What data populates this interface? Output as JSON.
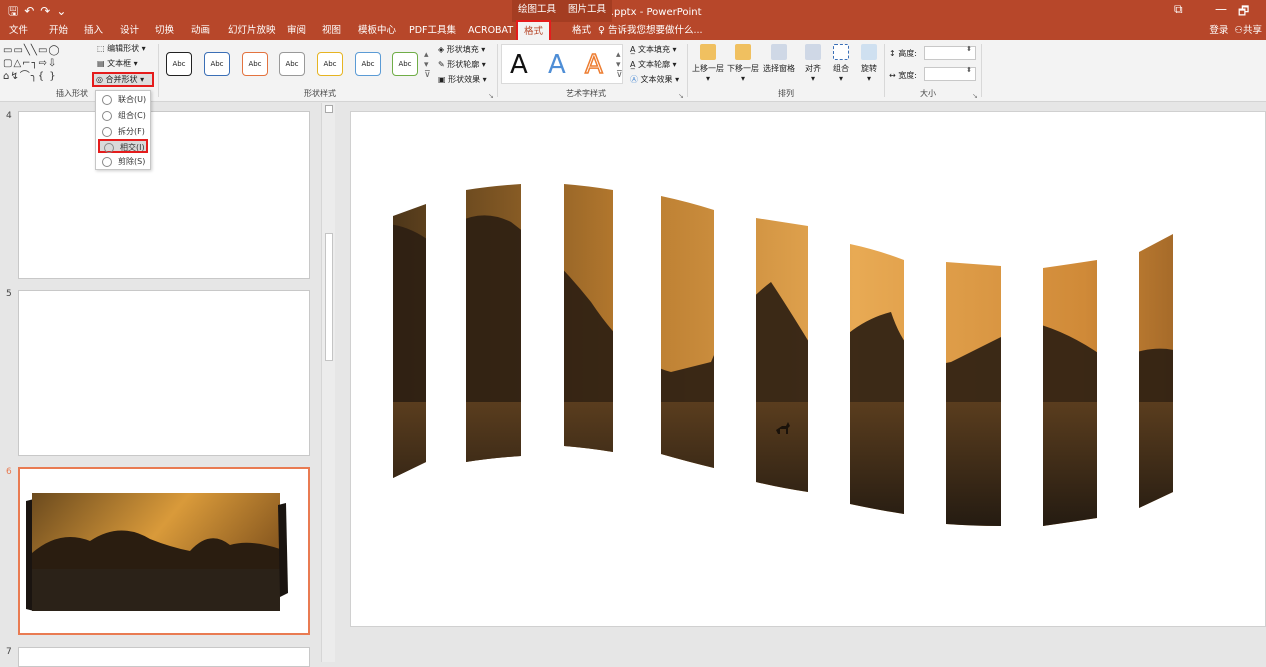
{
  "titlebar": {
    "doc_title": "演示文稿1.pptx - PowerPoint",
    "context_drawing_tools": "绘图工具",
    "context_picture_tools": "图片工具",
    "restore_icon_label": "⧉",
    "minimize_label": "—"
  },
  "menu": {
    "tabs": [
      "文件",
      "开始",
      "插入",
      "设计",
      "切换",
      "动画",
      "幻灯片放映",
      "审阅",
      "视图",
      "模板中心",
      "PDF工具集",
      "ACROBAT",
      "格式",
      "格式"
    ],
    "tell_me": "告诉我您想要做什么...",
    "login": "登录",
    "share": "共享"
  },
  "ribbon": {
    "insert_shapes": {
      "edit_shape": "编辑形状",
      "text_box": "文本框",
      "merge_shapes": "合并形状",
      "label": "插入形状"
    },
    "shape_styles": {
      "sample_text": "Abc",
      "fill": "形状填充",
      "outline": "形状轮廓",
      "effects": "形状效果",
      "label": "形状样式"
    },
    "wordart": {
      "letter": "A",
      "text_fill": "文本填充",
      "text_outline": "文本轮廓",
      "text_effects": "文本效果",
      "label": "艺术字样式"
    },
    "arrange": {
      "bring_forward": "上移一层",
      "send_backward": "下移一层",
      "selection_pane": "选择窗格",
      "align": "对齐",
      "group": "组合",
      "rotate": "旋转",
      "label": "排列"
    },
    "size": {
      "height": "高度:",
      "width": "宽度:",
      "label": "大小"
    }
  },
  "merge_dropdown": {
    "items": [
      "联合(U)",
      "组合(C)",
      "拆分(F)",
      "相交(I)",
      "剪除(S)"
    ],
    "selected_index": 3
  },
  "slides": {
    "numbers": [
      "4",
      "5",
      "6",
      "7"
    ],
    "selected": "6"
  },
  "colors": {
    "brand": "#b7472a",
    "highlight": "#e51c1c",
    "selection": "#e97b52"
  }
}
